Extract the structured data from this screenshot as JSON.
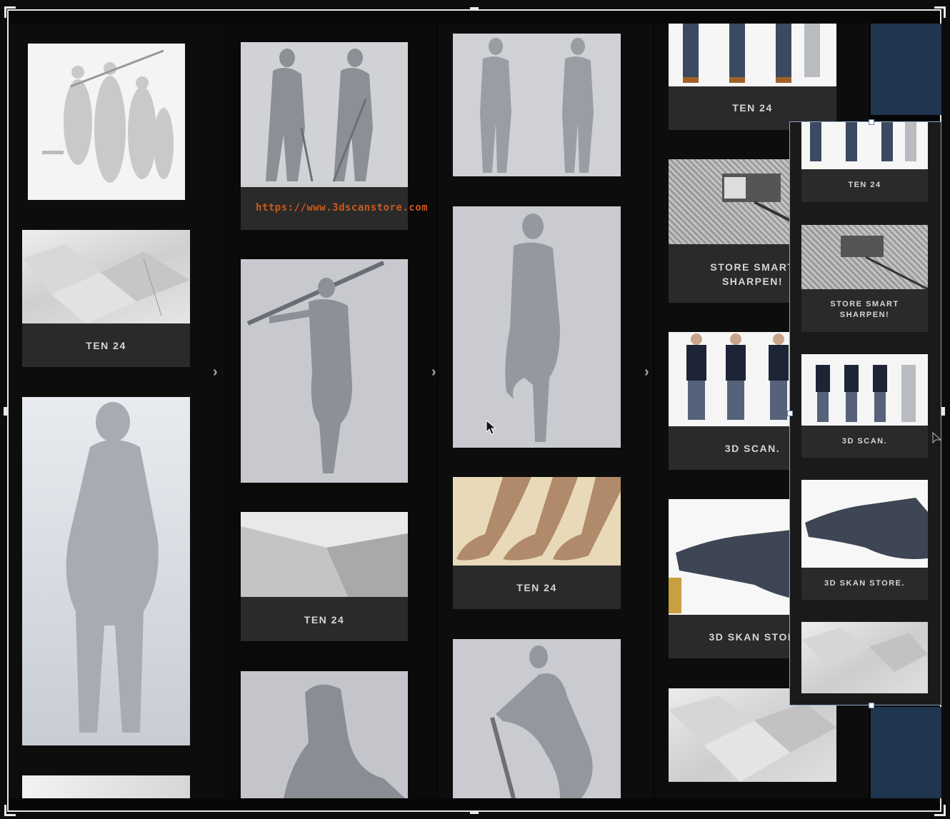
{
  "watermark_url": "https://www.3dscanstore.com",
  "columns": {
    "col1": {
      "card_label": "TEN 24"
    },
    "col2": {
      "card_label": "TEN 24"
    },
    "col3": {
      "card_label": "TEN 24"
    },
    "col4": {
      "cards": [
        "TEN 24",
        "STORE SMART\nSHARPEN!",
        "3D SCAN.",
        "3D SKAN STOR"
      ]
    }
  },
  "panel": {
    "cards": [
      "TEN 24",
      "STORE SMART\nSHARPEN!",
      "3D SCAN.",
      "3D SKAN STORE."
    ]
  },
  "icons": {
    "nav_arrow": "chevron-right-icon",
    "cursor": "mouse-pointer-icon"
  },
  "colors": {
    "background": "#0c0c0c",
    "card": "#2a2a2a",
    "accent_url": "#c85a1a",
    "panel_border": "#8ea8c8",
    "navy_block": "#1f3550"
  }
}
